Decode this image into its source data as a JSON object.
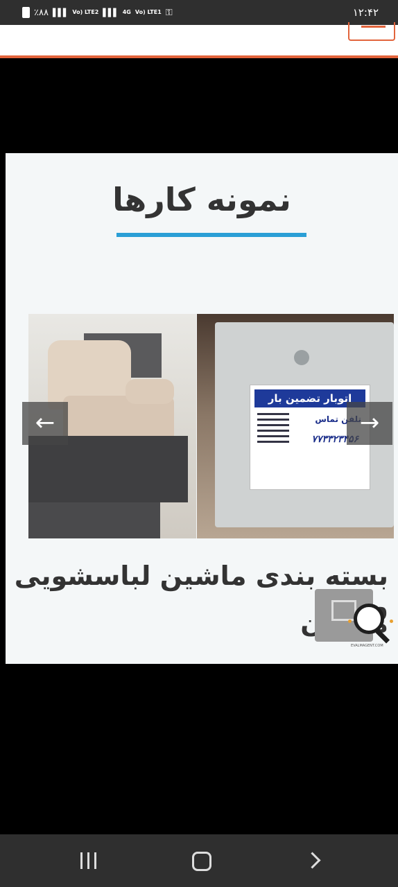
{
  "status_bar": {
    "battery": "٪۸۸",
    "sim2_label": "Vo) LTE2",
    "sim1_label": "Vo) LTE1",
    "network": "4G",
    "time": "۱۲:۴۲"
  },
  "colors": {
    "accent": "#e2643c",
    "title_underline": "#2a9fd6"
  },
  "slide": {
    "title": "نمونه کارها",
    "caption_line1": "بسته بندی ماشین لباسشویی و",
    "caption_line2": "مبلمان",
    "sticker_heading": "اتوبار تضمین بار",
    "sticker_sub": "تلفن تماس",
    "sticker_phone": "۷۷۳۳۲۳۴۵۶",
    "watermark": "EVALMAGENT.COM"
  },
  "icons": {
    "prev": "arrow-left-icon",
    "next": "arrow-right-icon",
    "menu": "hamburger-icon",
    "zoom": "magnifier-icon"
  },
  "system_nav": {
    "recents": "recents-icon",
    "home": "home-icon",
    "back": "back-chevron-icon"
  }
}
